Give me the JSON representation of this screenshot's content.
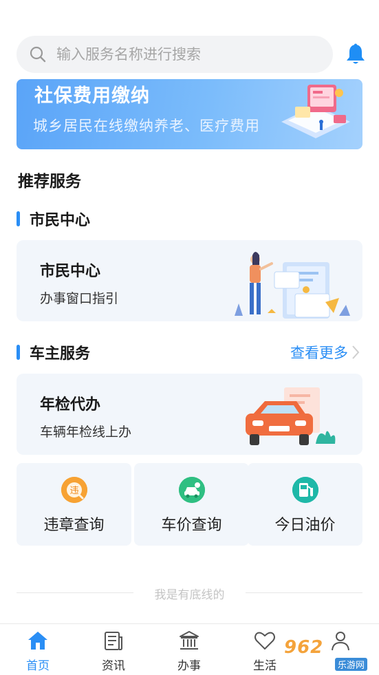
{
  "search": {
    "placeholder": "输入服务名称进行搜索"
  },
  "banner": {
    "title": "社保费用缴纳",
    "subtitle": "城乡居民在线缴纳养老、医疗费用"
  },
  "section": {
    "title": "推荐服务"
  },
  "groups": [
    {
      "label": "市民中心",
      "more": ""
    },
    {
      "label": "车主服务",
      "more": "查看更多"
    }
  ],
  "cards": [
    {
      "title": "市民中心",
      "desc": "办事窗口指引"
    },
    {
      "title": "年检代办",
      "desc": "车辆年检线上办"
    }
  ],
  "tiles": [
    {
      "label": "违章查询",
      "icon": "violation-icon",
      "color": "#f7a233"
    },
    {
      "label": "车价查询",
      "icon": "car-price-icon",
      "color": "#2fbf82"
    },
    {
      "label": "今日油价",
      "icon": "fuel-icon",
      "color": "#1fb8a8"
    }
  ],
  "footer": {
    "baseline": "我是有底线的"
  },
  "tabs": [
    {
      "label": "首页",
      "icon": "home-icon",
      "active": true
    },
    {
      "label": "资讯",
      "icon": "news-icon"
    },
    {
      "label": "办事",
      "icon": "government-icon"
    },
    {
      "label": "生活",
      "icon": "heart-icon"
    }
  ],
  "watermark": {
    "top": "962",
    "bottom": "乐游网"
  },
  "colors": {
    "accent": "#2a8ef5",
    "card_bg": "#f2f6fb",
    "bell": "#1f8ef5"
  }
}
